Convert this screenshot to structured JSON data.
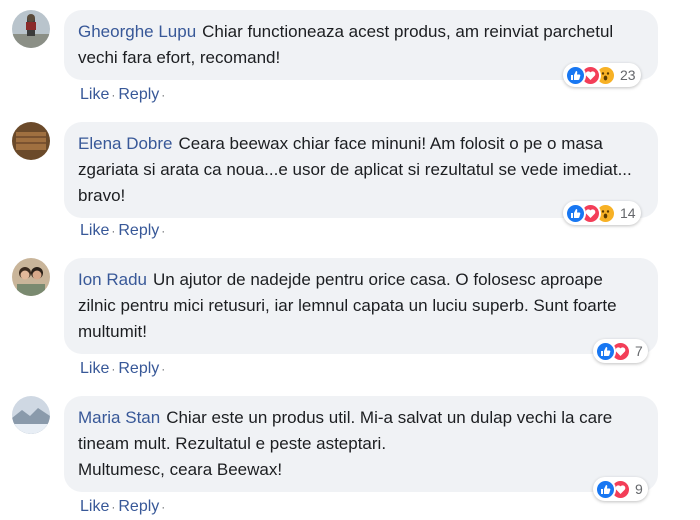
{
  "comments": [
    {
      "author": "Gheorghe Lupu",
      "text": "Chiar functioneaza acest produs, am reinviat parchetul vechi fara efort, recomand!",
      "reactions": [
        "like",
        "love",
        "wow"
      ],
      "reaction_count": "23"
    },
    {
      "author": "Elena Dobre",
      "text": "Ceara beewax chiar face minuni! Am folosit o pe o masa zgariata si arata ca noua...e usor de aplicat si rezultatul se vede imediat... bravo!",
      "reactions": [
        "like",
        "love",
        "wow"
      ],
      "reaction_count": "14"
    },
    {
      "author": "Ion Radu",
      "text": "Un ajutor de nadejde pentru orice casa. O folosesc aproape zilnic pentru mici retusuri, iar lemnul capata un luciu superb. Sunt foarte multumit!",
      "reactions": [
        "like",
        "love"
      ],
      "reaction_count": "7"
    },
    {
      "author": "Maria Stan",
      "text": "Chiar este un produs util. Mi-a salvat un dulap vechi la care tineam mult. Rezultatul e peste asteptari.",
      "text_line2": "Multumesc, ceara Beewax!",
      "reactions": [
        "like",
        "love"
      ],
      "reaction_count": "9"
    }
  ],
  "actions": {
    "like": "Like",
    "reply": "Reply",
    "dot": "·"
  },
  "colors": {
    "link": "#385898",
    "bubble": "#f0f2f5",
    "like": "#1877f2",
    "love": "#f33e58",
    "wow": "#f7b125"
  }
}
